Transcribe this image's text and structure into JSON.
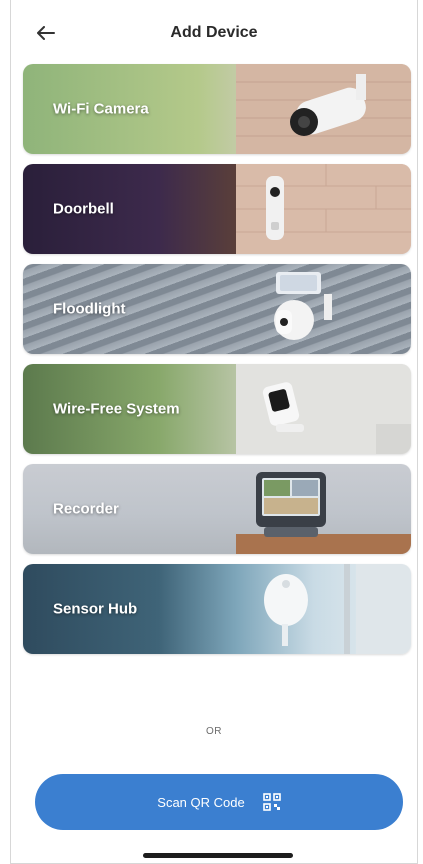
{
  "header": {
    "title": "Add Device",
    "back_icon": "arrow-left-icon"
  },
  "devices": [
    {
      "label": "Wi-Fi Camera"
    },
    {
      "label": "Doorbell"
    },
    {
      "label": "Floodlight"
    },
    {
      "label": "Wire-Free System"
    },
    {
      "label": "Recorder"
    },
    {
      "label": "Sensor Hub"
    }
  ],
  "separator": {
    "text": "OR"
  },
  "scan": {
    "label": "Scan QR Code",
    "icon": "qr-code-icon",
    "color": "#3b7fd0"
  }
}
